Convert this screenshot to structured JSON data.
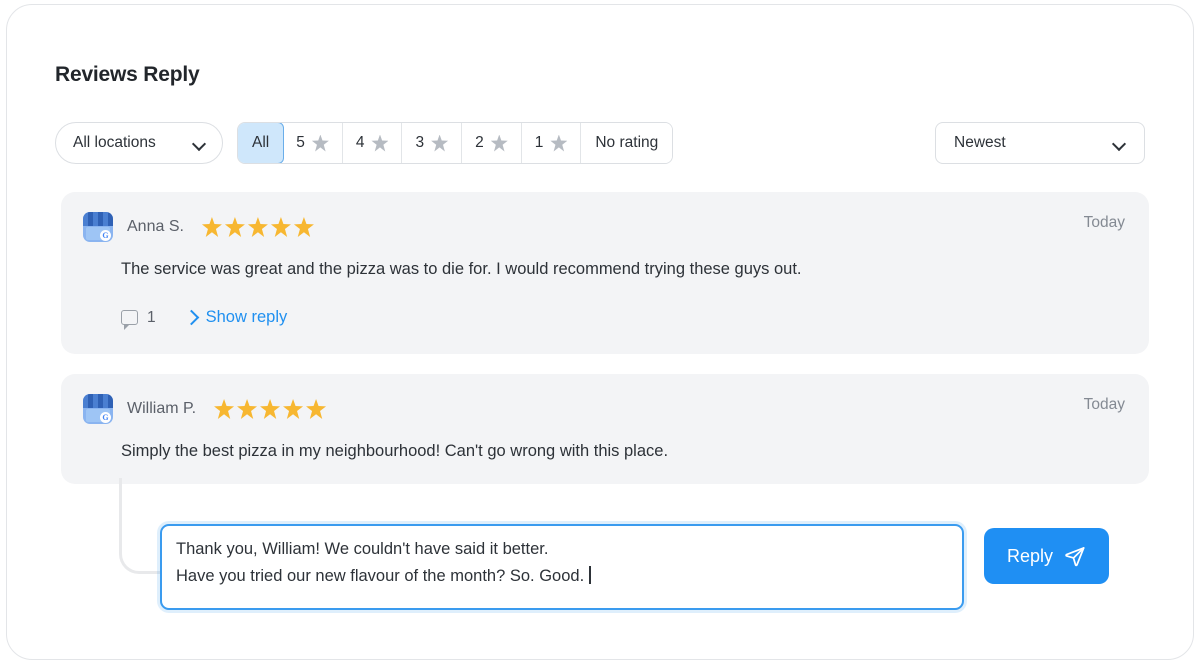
{
  "header": {
    "title": "Reviews Reply"
  },
  "filters": {
    "locations": {
      "label": "All locations",
      "icon": "chevron-down-icon"
    },
    "ratings": [
      {
        "label": "All",
        "star": false,
        "active": true
      },
      {
        "label": "5",
        "star": true,
        "active": false
      },
      {
        "label": "4",
        "star": true,
        "active": false
      },
      {
        "label": "3",
        "star": true,
        "active": false
      },
      {
        "label": "2",
        "star": true,
        "active": false
      },
      {
        "label": "1",
        "star": true,
        "active": false
      },
      {
        "label": "No rating",
        "star": false,
        "active": false
      }
    ],
    "sort": {
      "label": "Newest",
      "icon": "chevron-down-icon"
    }
  },
  "reviews": [
    {
      "author": "Anna S.",
      "avatar_icon": "google-business-profile-icon",
      "rating": 5,
      "date": "Today",
      "text": "The service was great and the pizza was to die for. I would recommend trying these guys out.",
      "reply_count": "1",
      "reply_count_icon": "comment-bubble-icon",
      "show_reply_label": "Show reply",
      "show_reply_icon": "chevron-right-icon",
      "has_actions": true
    },
    {
      "author": "William P.",
      "avatar_icon": "google-business-profile-icon",
      "rating": 5,
      "date": "Today",
      "text": "Simply the best pizza in my neighbourhood! Can't go wrong with this place.",
      "has_actions": false
    }
  ],
  "composer": {
    "line1": "Thank you, William! We couldn't have said it better.",
    "line2": "Have you tried our new flavour of the month? So. Good.",
    "button_label": "Reply",
    "button_icon": "send-paper-plane-icon"
  },
  "colors": {
    "accent": "#1f8ff3",
    "link": "#2090f0",
    "star_gold": "#f7b731",
    "star_gray": "#b6bbc2",
    "card_bg": "#f3f4f6",
    "active_filter_bg": "#cfe7fb",
    "active_filter_border": "#6aaeea"
  }
}
